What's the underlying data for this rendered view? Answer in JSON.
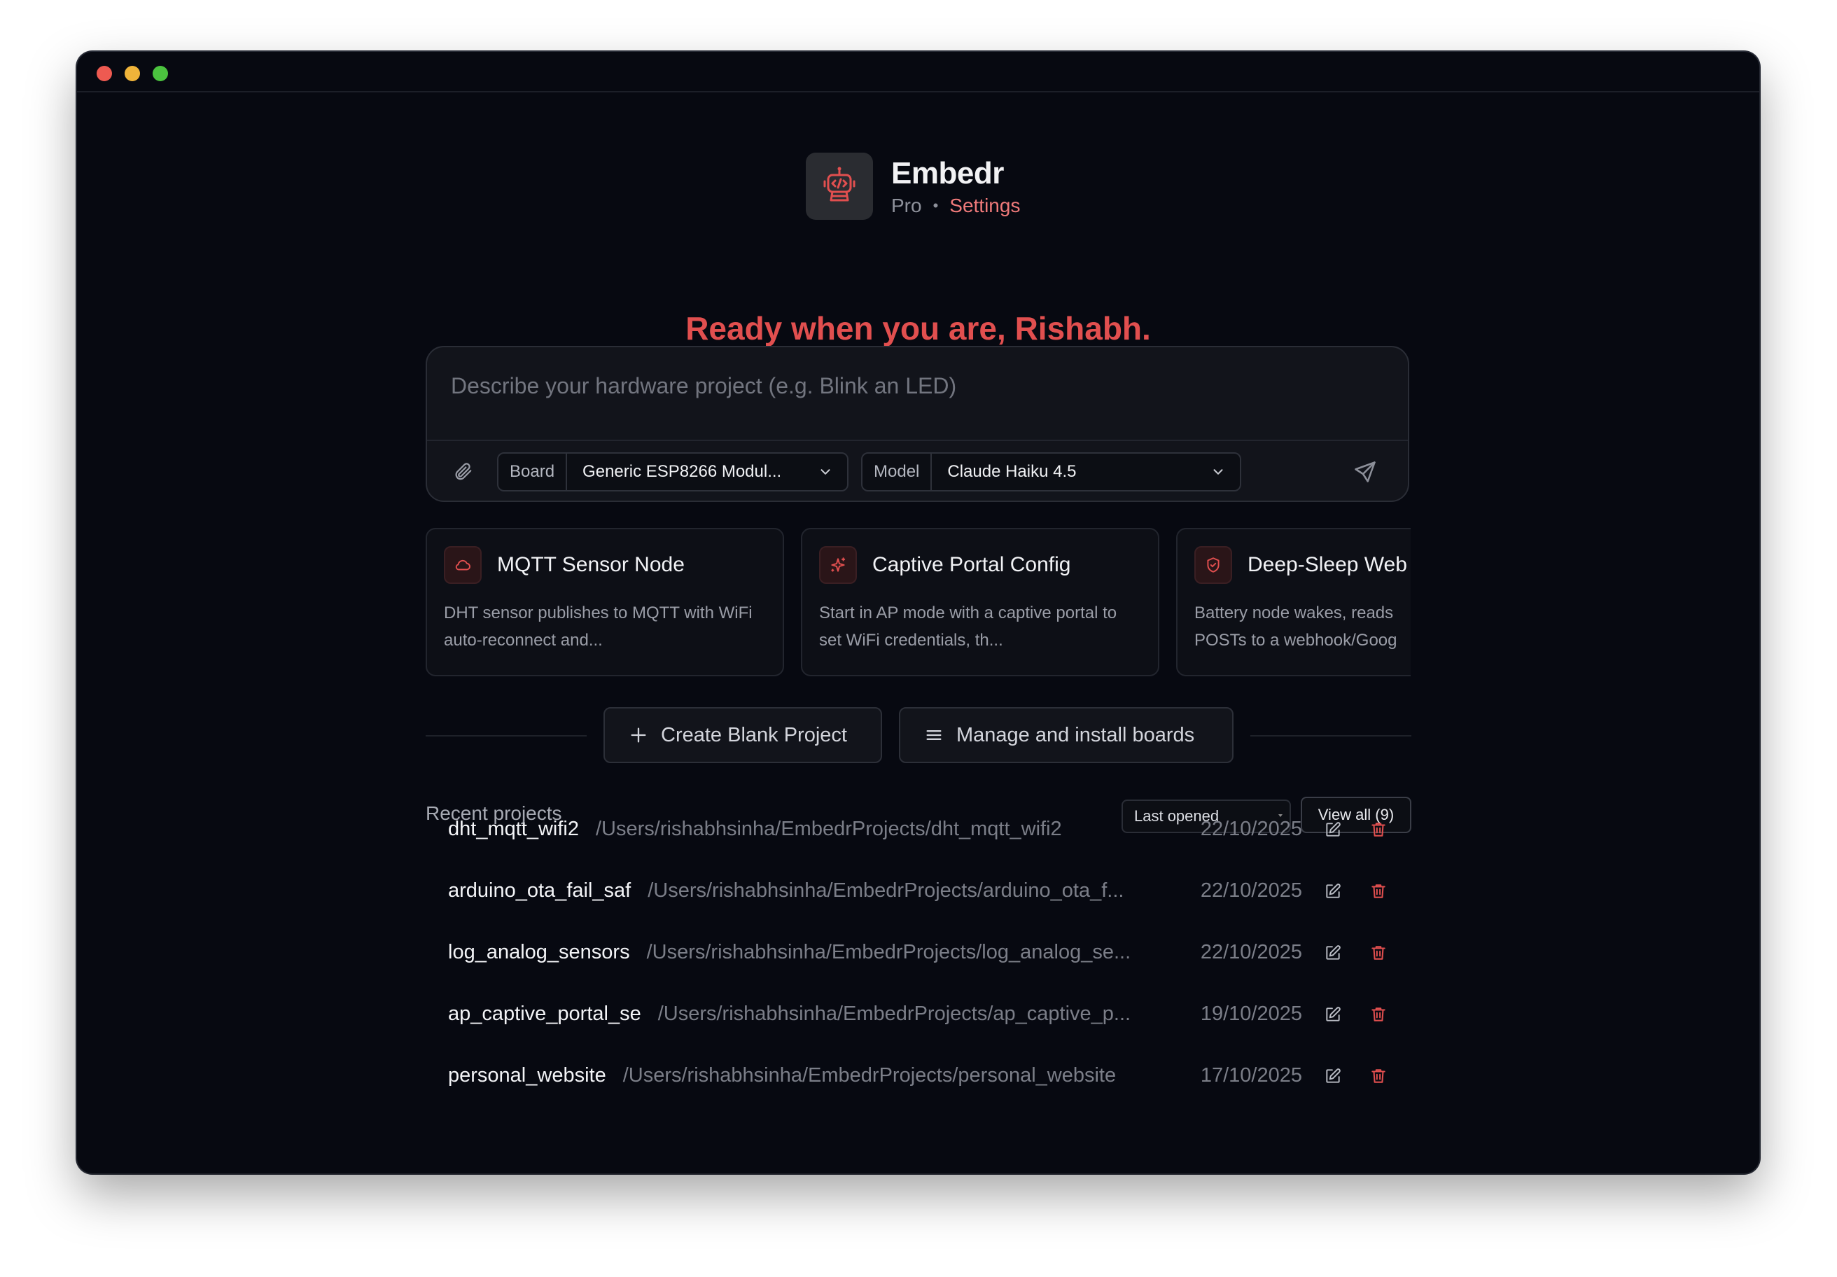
{
  "app": {
    "name": "Embedr",
    "plan": "Pro",
    "separator": "•",
    "settings_link": "Settings"
  },
  "greeting": "Ready when you are, Rishabh.",
  "prompt": {
    "placeholder": "Describe your hardware project (e.g. Blink an LED)",
    "value": "",
    "board_label": "Board",
    "board_value": "Generic ESP8266 Modul...",
    "model_label": "Model",
    "model_value": "Claude Haiku 4.5",
    "icons": {
      "attach": "paperclip-icon",
      "send": "send-icon",
      "dropdown": "chevron-down-icon"
    }
  },
  "templates": [
    {
      "title": "MQTT Sensor Node",
      "desc": "DHT sensor publishes to MQTT with WiFi auto-reconnect and...",
      "icon": "cloud-icon"
    },
    {
      "title": "Captive Portal Config",
      "desc": "Start in AP mode with a captive portal to set WiFi credentials, th...",
      "icon": "sparkle-icon"
    },
    {
      "title": "Deep-Sleep Web",
      "desc": "Battery node wakes, reads POSTs to a webhook/Goog",
      "icon": "shield-icon"
    }
  ],
  "actions": {
    "create_blank": "Create Blank Project",
    "manage_boards": "Manage and install boards"
  },
  "recent": {
    "title": "Recent projects",
    "sort_value": "Last opened",
    "view_all": "View all (9)",
    "projects": [
      {
        "name": "dht_mqtt_wifi2",
        "path": "/Users/rishabhsinha/EmbedrProjects/dht_mqtt_wifi2",
        "date": "22/10/2025"
      },
      {
        "name": "arduino_ota_fail_saf",
        "path": "/Users/rishabhsinha/EmbedrProjects/arduino_ota_f...",
        "date": "22/10/2025"
      },
      {
        "name": "log_analog_sensors",
        "path": "/Users/rishabhsinha/EmbedrProjects/log_analog_se...",
        "date": "22/10/2025"
      },
      {
        "name": "ap_captive_portal_se",
        "path": "/Users/rishabhsinha/EmbedrProjects/ap_captive_p...",
        "date": "19/10/2025"
      },
      {
        "name": "personal_website",
        "path": "/Users/rishabhsinha/EmbedrProjects/personal_website",
        "date": "17/10/2025"
      }
    ]
  },
  "colors": {
    "accent": "#e14f4f",
    "accent_light": "#f07a7a",
    "background": "#070911",
    "panel": "#12141b"
  }
}
